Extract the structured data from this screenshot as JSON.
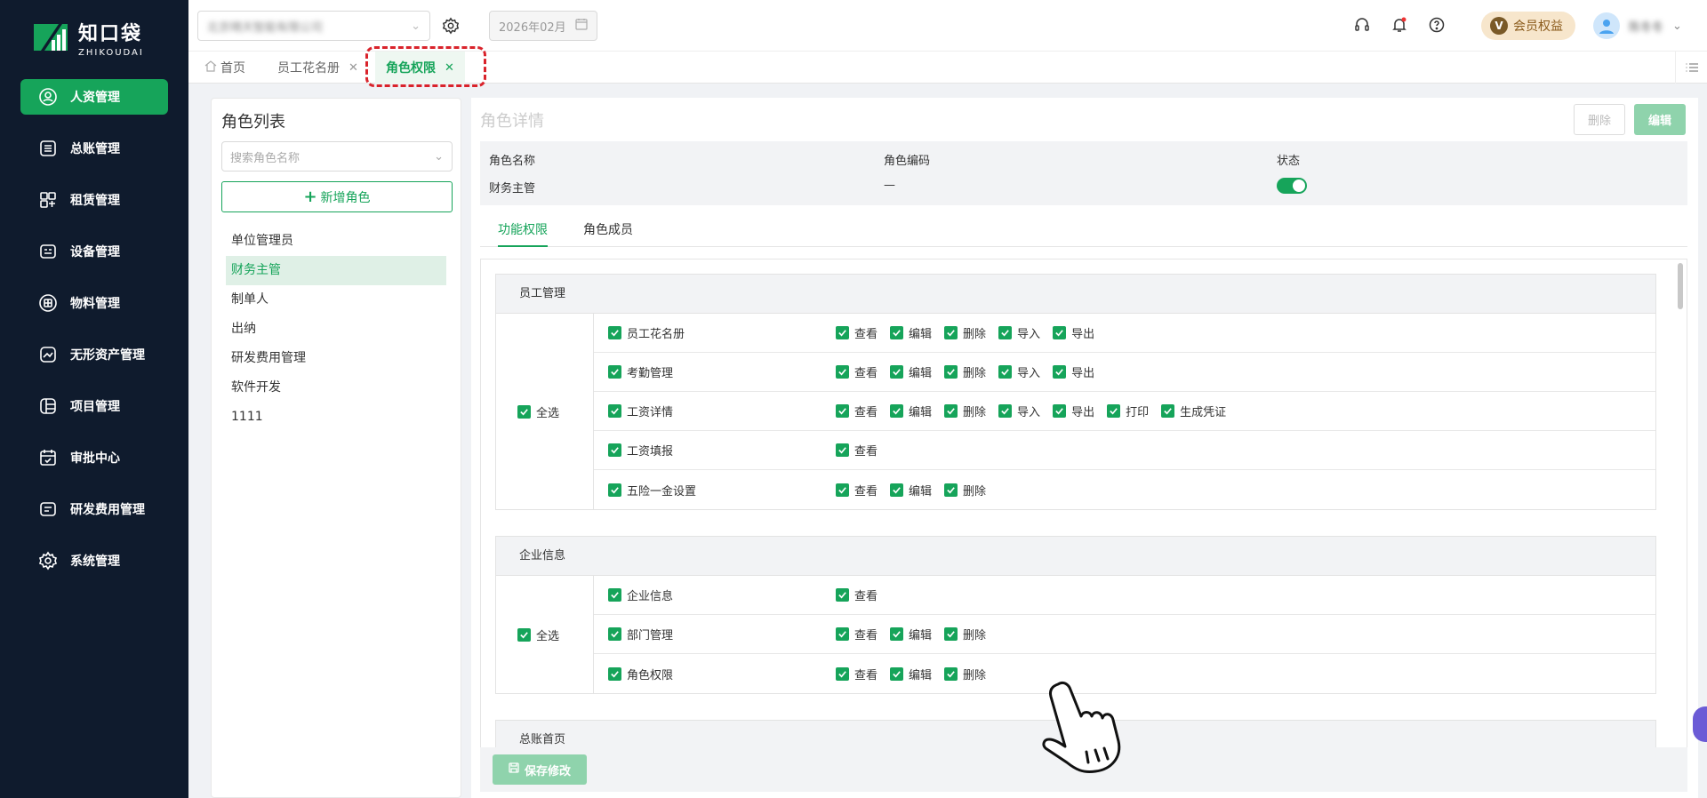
{
  "brand": {
    "name_cn": "知口袋",
    "name_en": "ZHIKOUDAI",
    "accent": "#16a45a",
    "sidebar_bg": "#0f1b2d"
  },
  "sidebar": {
    "items": [
      {
        "label": "人资管理",
        "icon": "person-icon",
        "active": true
      },
      {
        "label": "总账管理",
        "icon": "ledger-icon"
      },
      {
        "label": "租赁管理",
        "icon": "lease-icon"
      },
      {
        "label": "设备管理",
        "icon": "device-icon"
      },
      {
        "label": "物料管理",
        "icon": "material-icon"
      },
      {
        "label": "无形资产管理",
        "icon": "intangible-asset-icon"
      },
      {
        "label": "项目管理",
        "icon": "project-icon"
      },
      {
        "label": "审批中心",
        "icon": "approval-icon"
      },
      {
        "label": "研发费用管理",
        "icon": "rd-expense-icon"
      },
      {
        "label": "系统管理",
        "icon": "settings-icon"
      }
    ]
  },
  "topbar": {
    "company": "北京晴天智能有限公司",
    "period": "2026年02月",
    "vip_label": "会员权益",
    "vip_badge": "V",
    "user_name": "陈冬冬"
  },
  "tabs": [
    {
      "label": "首页",
      "icon": "home-icon"
    },
    {
      "label": "员工花名册",
      "closable": true
    },
    {
      "label": "角色权限",
      "closable": true,
      "active": true
    }
  ],
  "role_panel": {
    "title": "角色列表",
    "search_placeholder": "搜索角色名称",
    "add_label": "新增角色",
    "roles": [
      "单位管理员",
      "财务主管",
      "制单人",
      "出纳",
      "研发费用管理",
      "软件开发",
      "1111"
    ],
    "selected": "财务主管"
  },
  "detail": {
    "title": "角色详情",
    "delete_label": "删除",
    "edit_label": "编辑",
    "fields": {
      "name_label": "角色名称",
      "name_value": "财务主管",
      "code_label": "角色编码",
      "code_value": "—",
      "status_label": "状态",
      "status_on": true
    },
    "subtabs": [
      "功能权限",
      "角色成员"
    ],
    "select_all_label": "全选",
    "groups": [
      {
        "title": "员工管理",
        "rows": [
          {
            "name": "员工花名册",
            "actions": [
              "查看",
              "编辑",
              "删除",
              "导入",
              "导出"
            ]
          },
          {
            "name": "考勤管理",
            "actions": [
              "查看",
              "编辑",
              "删除",
              "导入",
              "导出"
            ]
          },
          {
            "name": "工资详情",
            "actions": [
              "查看",
              "编辑",
              "删除",
              "导入",
              "导出",
              "打印",
              "生成凭证"
            ]
          },
          {
            "name": "工资填报",
            "actions": [
              "查看"
            ]
          },
          {
            "name": "五险一金设置",
            "actions": [
              "查看",
              "编辑",
              "删除"
            ]
          }
        ]
      },
      {
        "title": "企业信息",
        "rows": [
          {
            "name": "企业信息",
            "actions": [
              "查看"
            ]
          },
          {
            "name": "部门管理",
            "actions": [
              "查看",
              "编辑",
              "删除"
            ]
          },
          {
            "name": "角色权限",
            "actions": [
              "查看",
              "编辑",
              "删除"
            ]
          }
        ]
      },
      {
        "title": "总账首页",
        "rows": []
      }
    ],
    "save_label": "保存修改"
  }
}
